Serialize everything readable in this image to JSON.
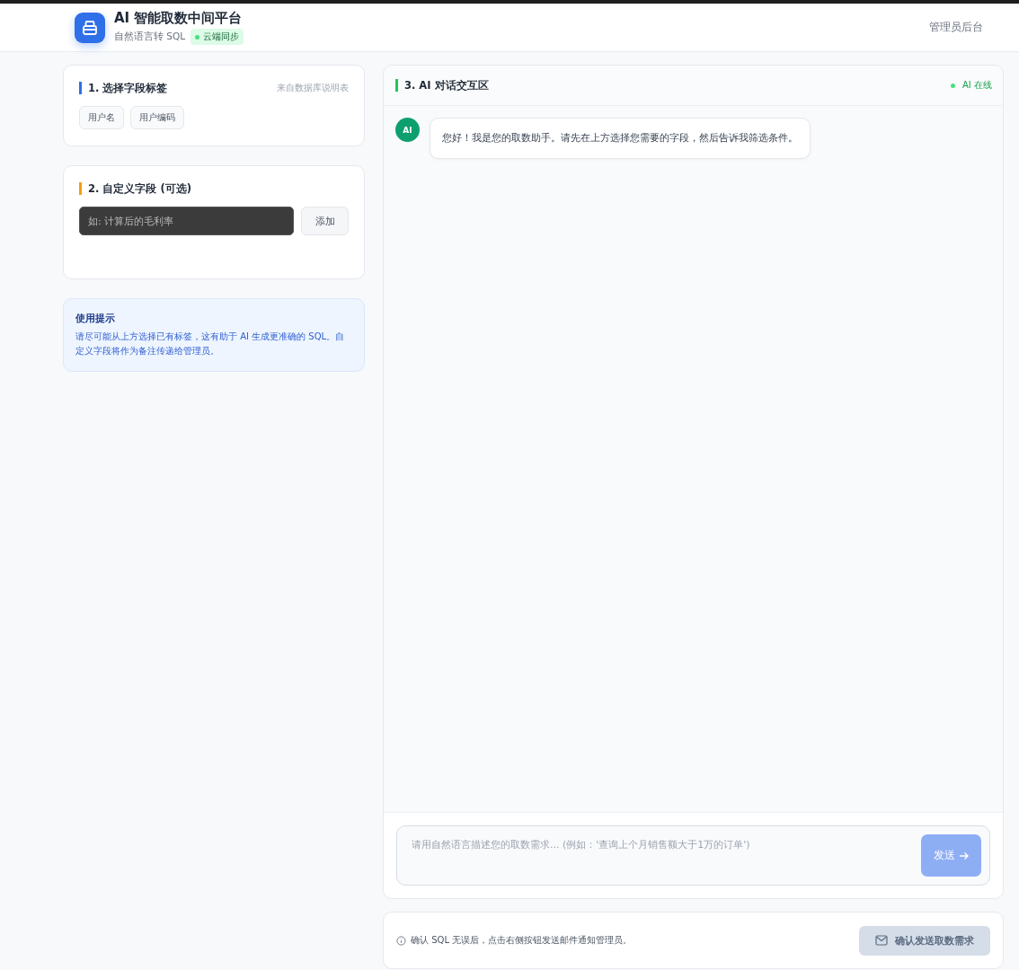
{
  "header": {
    "title": "AI 智能取数中间平台",
    "subtitle": "自然语言转 SQL",
    "sync_badge": {
      "label": "云端同步",
      "on": true
    },
    "admin_link": "管理员后台"
  },
  "field_tags": {
    "title": "1. 选择字段标签",
    "source": "来自数据库说明表",
    "tags": [
      {
        "label": "用户名",
        "selected": false
      },
      {
        "label": "用户编码",
        "selected": false
      }
    ]
  },
  "custom_field": {
    "title": "2. 自定义字段 (可选)",
    "placeholder": "如: 计算后的毛利率",
    "add_button": "添加"
  },
  "tips": {
    "title": "使用提示",
    "text": "请尽可能从上方选择已有标签，这有助于 AI 生成更准确的 SQL。自定义字段将作为备注传递给管理员。"
  },
  "chat": {
    "title": "3. AI 对话交互区",
    "status": {
      "label": "AI 在线",
      "online": true
    },
    "messages": [
      {
        "avatar": "AI",
        "text": "您好！我是您的取数助手。请先在上方选择您需要的字段，然后告诉我筛选条件。"
      }
    ],
    "input": {
      "placeholder": "请用自然语言描述您的取数需求... (例如：'查询上个月销售额大于1万的订单')",
      "send_button": "发送",
      "send_disabled": true
    }
  },
  "footer": {
    "hint": "确认 SQL 无误后，点击右侧按钮发送邮件通知管理员。",
    "confirm_button": "确认发送取数需求",
    "confirm_disabled": true
  }
}
